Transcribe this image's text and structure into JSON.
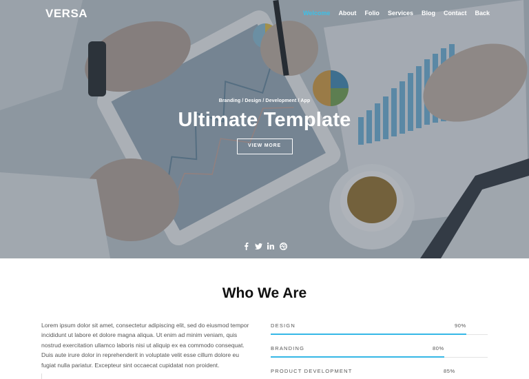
{
  "header": {
    "logo": "VERSA",
    "nav": [
      "Welcome",
      "About",
      "Folio",
      "Services",
      "Blog",
      "Contact",
      "Back"
    ],
    "active_color": "#3bc0e8"
  },
  "hero": {
    "kicker": "Branding / Design / Development / App",
    "title": "Ultimate Template",
    "button": "VIEW MORE",
    "social_icons": [
      "facebook-icon",
      "twitter-icon",
      "linkedin-icon",
      "dribbble-icon"
    ]
  },
  "about": {
    "title": "Who We Are",
    "text": "Lorem ipsum dolor sit amet, consectetur adipiscing elit, sed do eiusmod tempor incididunt ut labore et dolore magna aliqua. Ut enim ad minim veniam, quis nostrud exercitation ullamco laboris nisi ut aliquip ex ea commodo consequat. Duis aute irure dolor in reprehenderit in voluptate velit esse cillum dolore eu fugiat nulla pariatur. Excepteur sint occaecat cupidatat non proident.",
    "skills": [
      {
        "label": "DESIGN",
        "value": "90%",
        "fraction": 0.9
      },
      {
        "label": "BRANDING",
        "value": "80%",
        "fraction": 0.8
      },
      {
        "label": "PRODUCT DEVELOPMENT",
        "value": "85%",
        "fraction": 0.85
      }
    ],
    "accent": "#34b7e6"
  }
}
